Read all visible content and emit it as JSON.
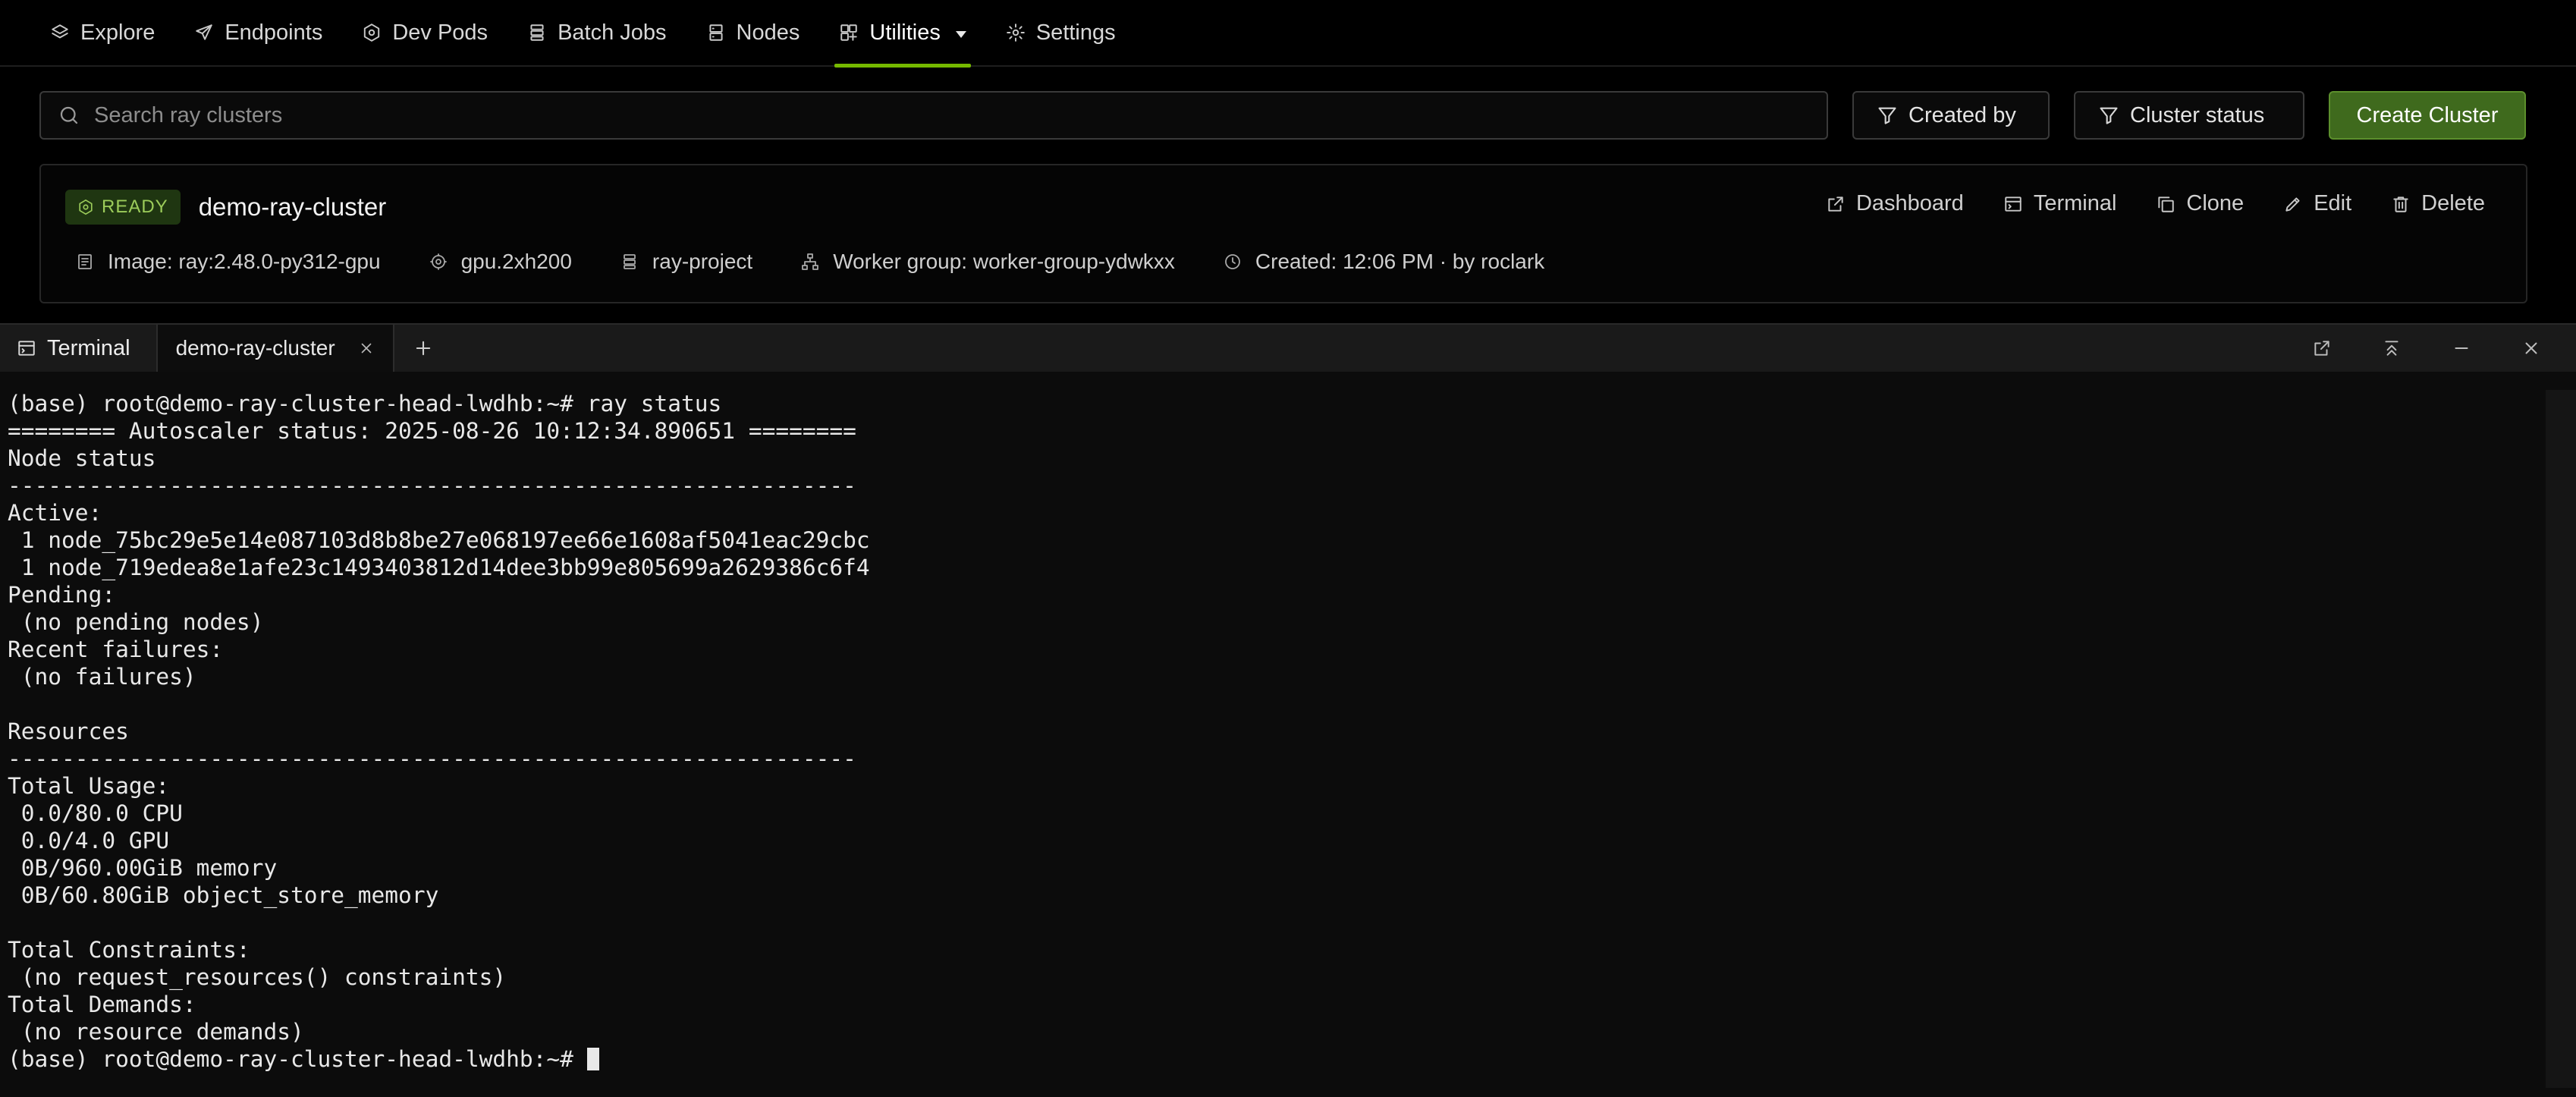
{
  "nav": {
    "items": [
      {
        "label": "Explore",
        "icon": "layers-icon"
      },
      {
        "label": "Endpoints",
        "icon": "paper-plane-icon"
      },
      {
        "label": "Dev Pods",
        "icon": "hexagon-icon"
      },
      {
        "label": "Batch Jobs",
        "icon": "stack-icon"
      },
      {
        "label": "Nodes",
        "icon": "server-icon"
      },
      {
        "label": "Utilities",
        "icon": "grid-icon",
        "active": true
      },
      {
        "label": "Settings",
        "icon": "gear-icon"
      }
    ],
    "accent_color": "#76b900"
  },
  "search": {
    "placeholder": "Search ray clusters",
    "value": ""
  },
  "filters": {
    "created_by": "Created by",
    "cluster_status": "Cluster status"
  },
  "create_button": "Create Cluster",
  "cluster": {
    "status": "READY",
    "name": "demo-ray-cluster",
    "actions": {
      "dashboard": "Dashboard",
      "terminal": "Terminal",
      "clone": "Clone",
      "edit": "Edit",
      "delete": "Delete"
    },
    "meta": {
      "image": "Image: ray:2.48.0-py312-gpu",
      "instance": "gpu.2xh200",
      "project": "ray-project",
      "worker_group": "Worker group: worker-group-ydwkxx",
      "created": "Created: 12:06 PM · by roclark"
    }
  },
  "panel": {
    "title": "Terminal",
    "tab_label": "demo-ray-cluster"
  },
  "terminal": {
    "output": "(base) root@demo-ray-cluster-head-lwdhb:~# ray status\n======== Autoscaler status: 2025-08-26 10:12:34.890651 ========\nNode status\n---------------------------------------------------------------\nActive:\n 1 node_75bc29e5e14e087103d8b8be27e068197ee66e1608af5041eac29cbc\n 1 node_719edea8e1afe23c1493403812d14dee3bb99e805699a2629386c6f4\nPending:\n (no pending nodes)\nRecent failures:\n (no failures)\n\nResources\n---------------------------------------------------------------\nTotal Usage:\n 0.0/80.0 CPU\n 0.0/4.0 GPU\n 0B/960.00GiB memory\n 0B/60.80GiB object_store_memory\n\nTotal Constraints:\n (no request_resources() constraints)\nTotal Demands:\n (no resource demands)",
    "prompt": "(base) root@demo-ray-cluster-head-lwdhb:~# "
  }
}
